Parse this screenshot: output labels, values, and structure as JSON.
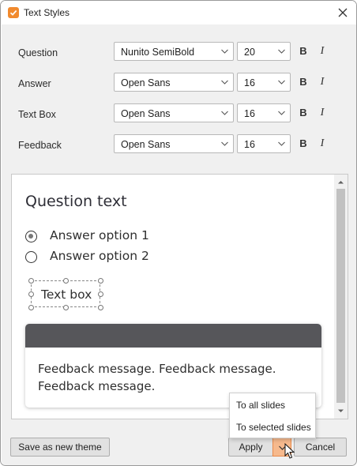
{
  "window": {
    "title": "Text Styles",
    "accent_color": "#f18a2e",
    "icons": {
      "app": "checkbox-app-icon",
      "close": "close-icon"
    }
  },
  "styles": [
    {
      "label": "Question",
      "font": "Nunito SemiBold",
      "size": "20",
      "bold_label": "B",
      "italic_label": "I"
    },
    {
      "label": "Answer",
      "font": "Open Sans",
      "size": "16",
      "bold_label": "B",
      "italic_label": "I"
    },
    {
      "label": "Text Box",
      "font": "Open Sans",
      "size": "16",
      "bold_label": "B",
      "italic_label": "I"
    },
    {
      "label": "Feedback",
      "font": "Open Sans",
      "size": "16",
      "bold_label": "B",
      "italic_label": "I"
    }
  ],
  "preview": {
    "question": "Question text",
    "answers": [
      {
        "text": "Answer option 1",
        "selected": true
      },
      {
        "text": "Answer option 2",
        "selected": false
      }
    ],
    "text_box": "Text box",
    "feedback": "Feedback message. Feedback message. Feedback message.",
    "feedback_header_color": "#56565a"
  },
  "footer": {
    "save_theme": "Save as new theme",
    "apply": "Apply",
    "cancel": "Cancel",
    "apply_menu": [
      "To all slides",
      "To selected slides"
    ]
  }
}
